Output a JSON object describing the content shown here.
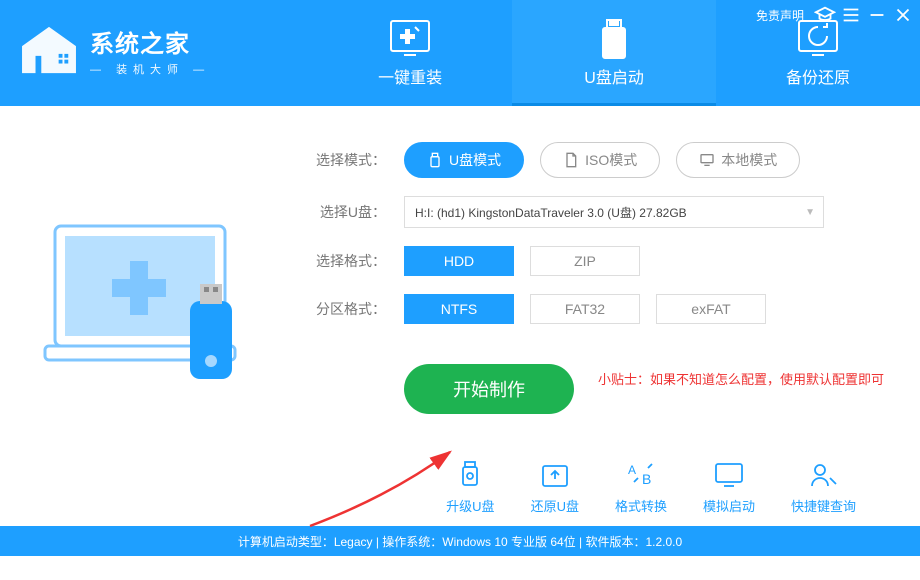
{
  "titlebar": {
    "disclaimer": "免责声明"
  },
  "logo": {
    "title": "系统之家",
    "subtitle": "装机大师"
  },
  "nav": {
    "reinstall": "一键重装",
    "usbboot": "U盘启动",
    "backup": "备份还原"
  },
  "modes": {
    "label": "选择模式：",
    "usb": "U盘模式",
    "iso": "ISO模式",
    "local": "本地模式"
  },
  "usb": {
    "label": "选择U盘：",
    "value": "H:I: (hd1) KingstonDataTraveler 3.0 (U盘) 27.82GB"
  },
  "format": {
    "label": "选择格式：",
    "hdd": "HDD",
    "zip": "ZIP"
  },
  "partition": {
    "label": "分区格式：",
    "ntfs": "NTFS",
    "fat32": "FAT32",
    "exfat": "exFAT"
  },
  "start_label": "开始制作",
  "tip": "小贴士：如果不知道怎么配置，使用默认配置即可",
  "shortcuts": {
    "upgrade": "升级U盘",
    "restore": "还原U盘",
    "convert": "格式转换",
    "simulate": "模拟启动",
    "hotkey": "快捷键查询"
  },
  "footer": "计算机启动类型：Legacy | 操作系统：Windows 10 专业版 64位 | 软件版本：1.2.0.0"
}
